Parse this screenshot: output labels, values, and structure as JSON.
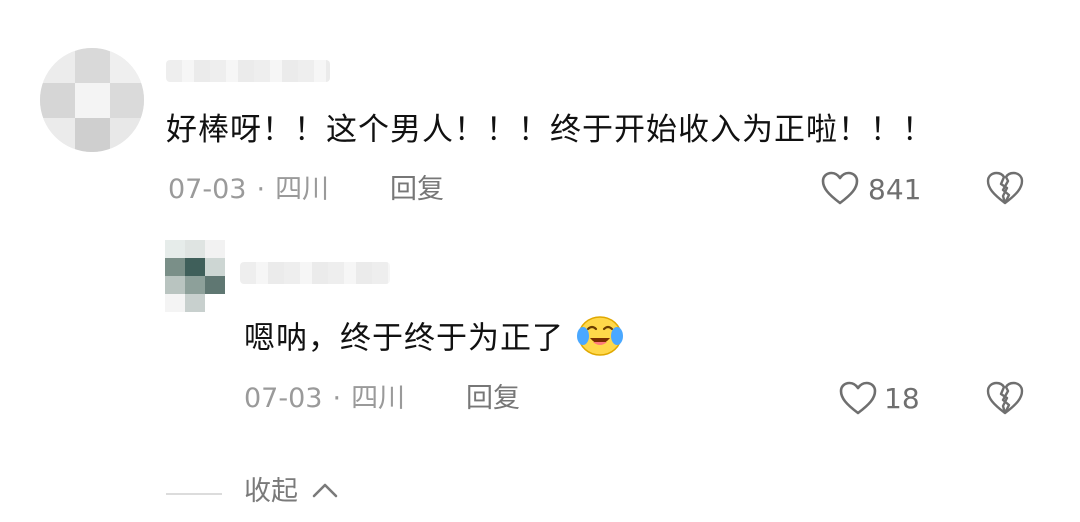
{
  "comment": {
    "text": "好棒呀！！这个男人！！！终于开始收入为正啦！！！",
    "date": "07-03",
    "location": "四川",
    "reply_label": "回复",
    "like_count": "841",
    "like_icon": "heart-outline-icon",
    "dislike_icon": "broken-heart-icon"
  },
  "reply": {
    "text": "嗯呐，终于终于为正了",
    "emoji": "crying-laughing-emoji",
    "date": "07-03",
    "location": "四川",
    "reply_label": "回复",
    "like_count": "18",
    "like_icon": "heart-outline-icon",
    "dislike_icon": "broken-heart-icon"
  },
  "footer": {
    "collapse_label": "收起",
    "collapse_icon": "chevron-up-icon"
  },
  "colors": {
    "text": "#111111",
    "meta": "#9a9a9a",
    "icon": "#6f6f6f",
    "emoji_yellow": "#ffd84a",
    "emoji_tear": "#4aa8ff"
  }
}
